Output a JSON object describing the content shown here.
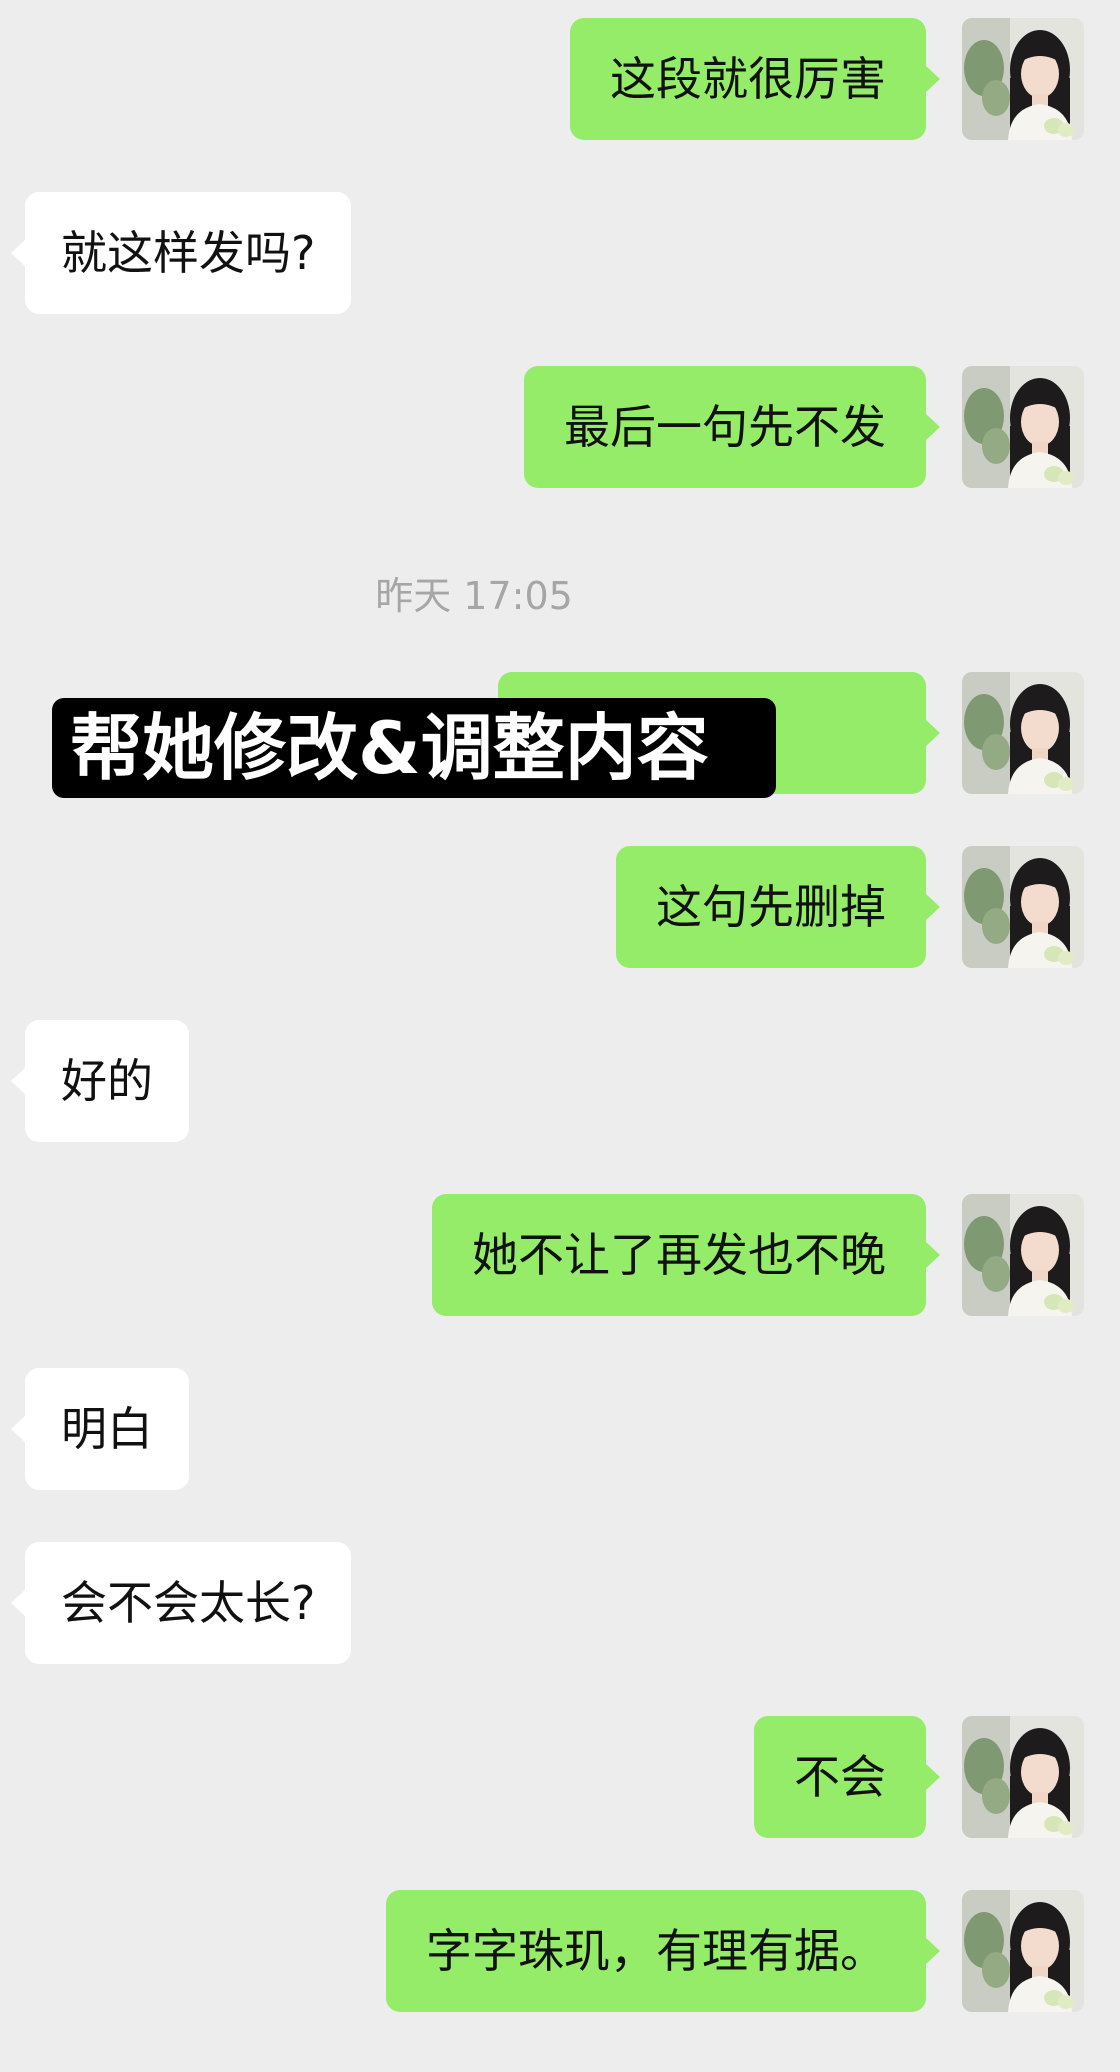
{
  "chat": {
    "messages": [
      {
        "side": "me",
        "text": "这段就很厉害"
      },
      {
        "side": "them",
        "text": "就这样发吗?"
      },
      {
        "side": "me",
        "text": "最后一句先不发"
      },
      {
        "side": "me",
        "text": "",
        "blurred": true
      },
      {
        "side": "me",
        "text": "这句先删掉"
      },
      {
        "side": "them",
        "text": "好的"
      },
      {
        "side": "me",
        "text": "她不让了再发也不晚"
      },
      {
        "side": "them",
        "text": "明白"
      },
      {
        "side": "them",
        "text": "会不会太长?"
      },
      {
        "side": "me",
        "text": "不会"
      },
      {
        "side": "me",
        "text": "字字珠玑，有理有据。"
      }
    ],
    "timestamp": "昨天 17:05"
  },
  "overlay": {
    "caption": "帮她修改&调整内容"
  },
  "colors": {
    "background": "#ededed",
    "me_bubble": "#95ec69",
    "them_bubble": "#ffffff",
    "timestamp_text": "#a6a6a6"
  },
  "icons": {
    "avatar": "user-avatar-photo"
  }
}
